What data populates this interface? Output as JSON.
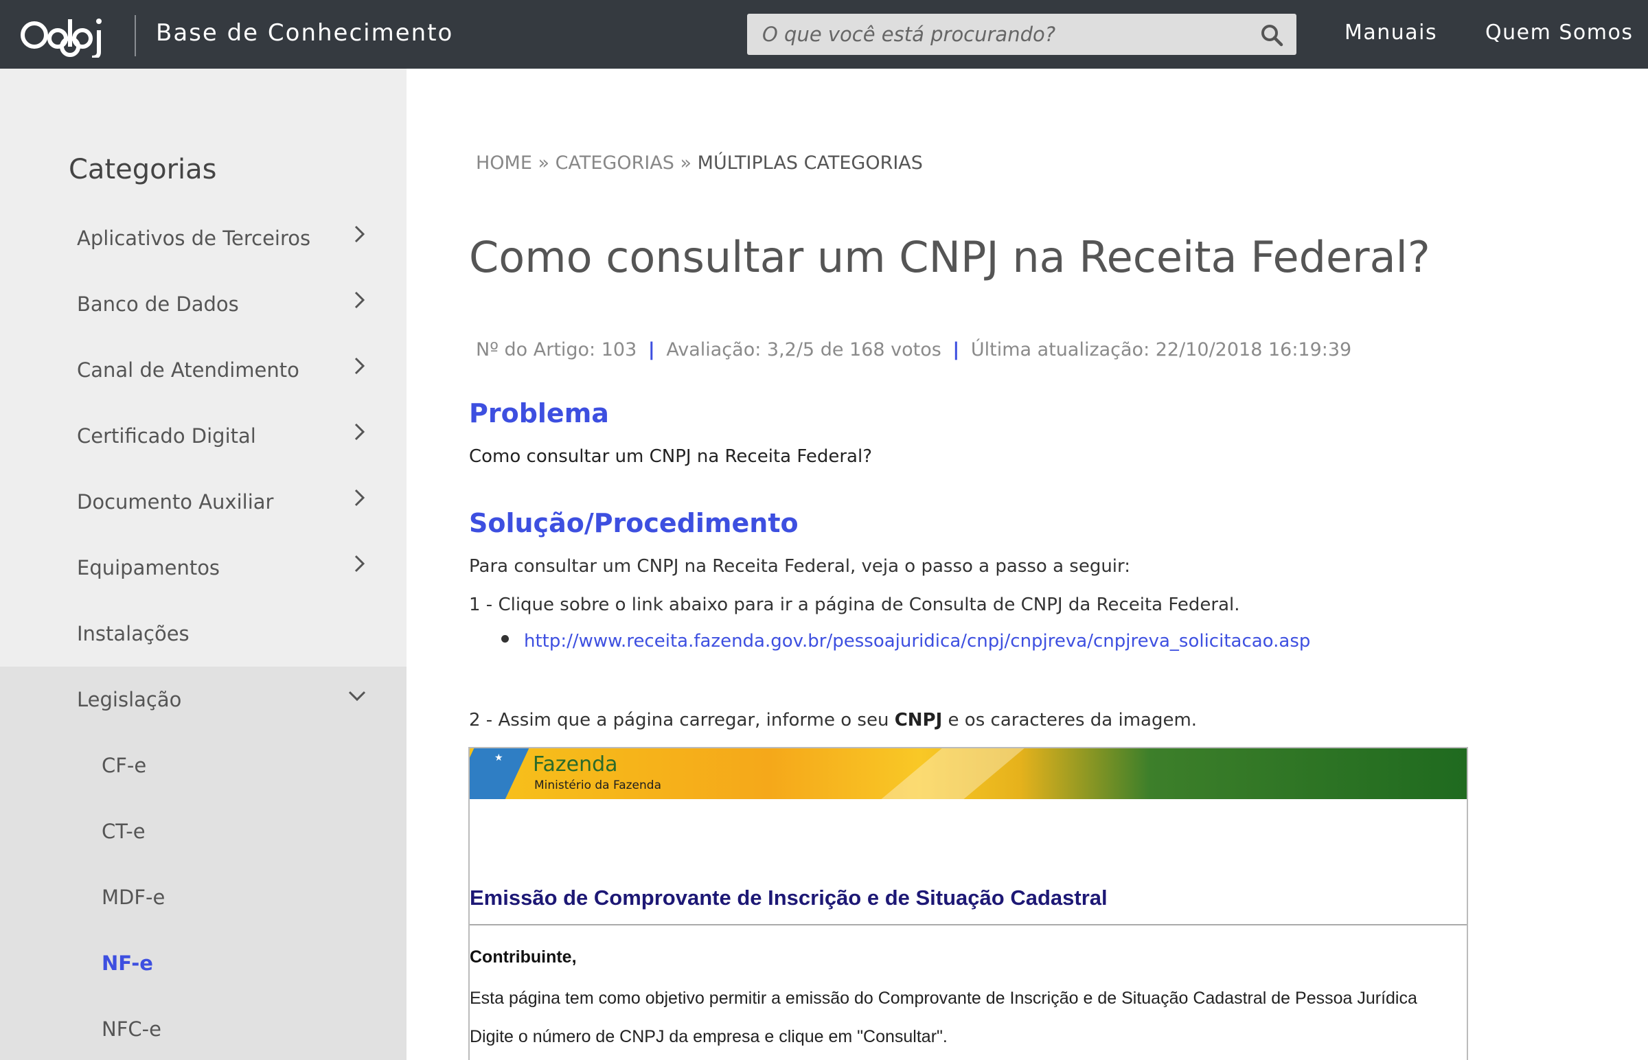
{
  "header": {
    "logo_text": "Oobj",
    "site_title": "Base de Conhecimento",
    "search_placeholder": "O que você está procurando?",
    "nav": [
      "Manuais",
      "Quem Somos"
    ]
  },
  "sidebar": {
    "heading": "Categorias",
    "items": [
      {
        "label": "Aplicativos de Terceiros",
        "chevron": "right"
      },
      {
        "label": "Banco de Dados",
        "chevron": "right"
      },
      {
        "label": "Canal de Atendimento",
        "chevron": "right"
      },
      {
        "label": "Certificado Digital",
        "chevron": "right"
      },
      {
        "label": "Documento Auxiliar",
        "chevron": "right"
      },
      {
        "label": "Equipamentos",
        "chevron": "right"
      },
      {
        "label": "Instalações",
        "chevron": "none"
      },
      {
        "label": "Legislação",
        "chevron": "down"
      }
    ],
    "subitems": [
      {
        "label": "CF-e",
        "active": false
      },
      {
        "label": "CT-e",
        "active": false
      },
      {
        "label": "MDF-e",
        "active": false
      },
      {
        "label": "NF-e",
        "active": true
      },
      {
        "label": "NFC-e",
        "active": false
      }
    ]
  },
  "breadcrumb": {
    "home": "HOME",
    "sep": "»",
    "categories": "CATEGORIAS",
    "current": "MÚLTIPLAS CATEGORIAS"
  },
  "article": {
    "title": "Como consultar um CNPJ na Receita Federal?",
    "meta": {
      "number": "Nº do Artigo: 103",
      "rating": "Avaliação: 3,2/5 de 168 votos",
      "updated": "Última atualização: 22/10/2018 16:19:39",
      "separator": "|"
    },
    "problem_heading": "Problema",
    "problem_text": "Como consultar um CNPJ na Receita Federal?",
    "solution_heading": "Solução/Procedimento",
    "intro": "Para consultar um CNPJ na Receita Federal, veja o passo a passo a seguir:",
    "step1": "1 - Clique sobre o link abaixo para ir a página de Consulta de CNPJ da Receita Federal.",
    "link": "http://www.receita.fazenda.gov.br/pessoajuridica/cnpj/cnpjreva/cnpjreva_solicitacao.asp",
    "step2_pre": "2 - Assim que a página carregar, informe o seu ",
    "step2_bold": "CNPJ",
    "step2_post": " e os caracteres da imagem."
  },
  "embedded": {
    "banner_title": "Fazenda",
    "banner_subtitle": "Ministério da Fazenda",
    "heading": "Emissão de Comprovante de Inscrição e de Situação Cadastral",
    "greeting": "Contribuinte,",
    "line1": "Esta página tem como objetivo permitir a emissão do Comprovante de Inscrição e de Situação Cadastral de Pessoa Jurídica",
    "line2": "Digite o número de CNPJ da empresa e clique em \"Consultar\"."
  },
  "colors": {
    "topbar": "#353a40",
    "accent": "#3d4fe0",
    "sidebar_bg": "#eeeeee",
    "sidebar_sub_bg": "#e1e1e1"
  }
}
